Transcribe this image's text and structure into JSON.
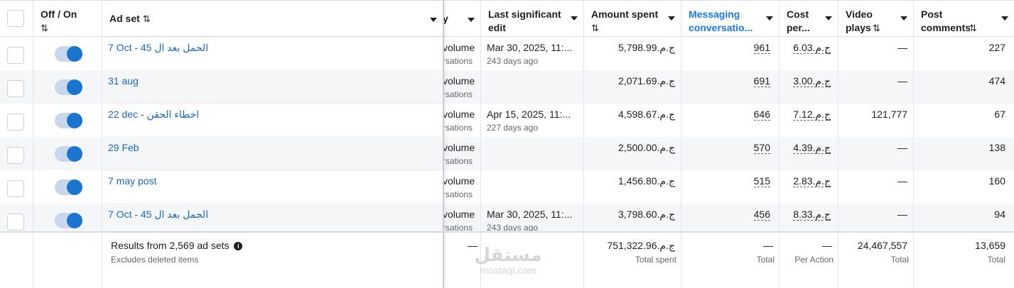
{
  "header": {
    "toggle_label": "Off / On",
    "adset_label": "Ad set",
    "delivery_label": "y",
    "edit_label": "Last significant edit",
    "amount_label": "Amount spent",
    "msg_label": "Messaging conversatio...",
    "cost_label": "Cost per...",
    "video_label": "Video plays",
    "comments_label": "Post comments",
    "sort_glyph": "⇅",
    "accent_color": "#1877f2"
  },
  "rows": [
    {
      "name": "7 Oct - 45 الحمل بعد ال",
      "delivery": "volume",
      "delivery_sub": "rsations",
      "edit": "Mar 30, 2025, 11:...",
      "edit_sub": "243 days ago",
      "amount": "ج.م.5,798.99",
      "msg": "961",
      "cost": "ج.م.6.03",
      "video": "—",
      "comments": "227"
    },
    {
      "name": "31 aug",
      "delivery": "volume",
      "delivery_sub": "rsations",
      "edit": "",
      "edit_sub": "",
      "amount": "ج.م.2,071.69",
      "msg": "691",
      "cost": "ج.م.3.00",
      "video": "—",
      "comments": "474"
    },
    {
      "name": "22 dec - اخطاء الحقن",
      "delivery": "volume",
      "delivery_sub": "rsations",
      "edit": "Apr 15, 2025, 11:...",
      "edit_sub": "227 days ago",
      "amount": "ج.م.4,598.67",
      "msg": "646",
      "cost": "ج.م.7.12",
      "video": "121,777",
      "comments": "67"
    },
    {
      "name": "29 Feb",
      "delivery": "volume",
      "delivery_sub": "rsations",
      "edit": "",
      "edit_sub": "",
      "amount": "ج.م.2,500.00",
      "msg": "570",
      "cost": "ج.م.4.39",
      "video": "—",
      "comments": "138"
    },
    {
      "name": "7 may post",
      "delivery": "volume",
      "delivery_sub": "rsations",
      "edit": "",
      "edit_sub": "",
      "amount": "ج.م.1,456.80",
      "msg": "515",
      "cost": "ج.م.2.83",
      "video": "—",
      "comments": "160"
    },
    {
      "name": "7 Oct - 45 الحمل بعد ال",
      "delivery": "volume",
      "delivery_sub": "rsations",
      "edit": "Mar 30, 2025, 11:...",
      "edit_sub": "243 days ago",
      "amount": "ج.م.3,798.60",
      "msg": "456",
      "cost": "ج.م.8.33",
      "video": "—",
      "comments": "94"
    }
  ],
  "footer": {
    "results_title": "Results from 2,569 ad sets",
    "info_glyph": "i",
    "results_sub": "Excludes deleted items",
    "delivery_total": "—",
    "amount_total": "ج.م.751,322.96",
    "amount_label": "Total spent",
    "msg_total": "—",
    "msg_label": "Total",
    "cost_total": "—",
    "cost_label": "Per Action",
    "video_total": "24,467,557",
    "video_label": "Total",
    "comments_total": "13,659",
    "comments_label": "Total"
  },
  "watermark": {
    "logo": "مستقل",
    "text": "mostaql.com"
  }
}
